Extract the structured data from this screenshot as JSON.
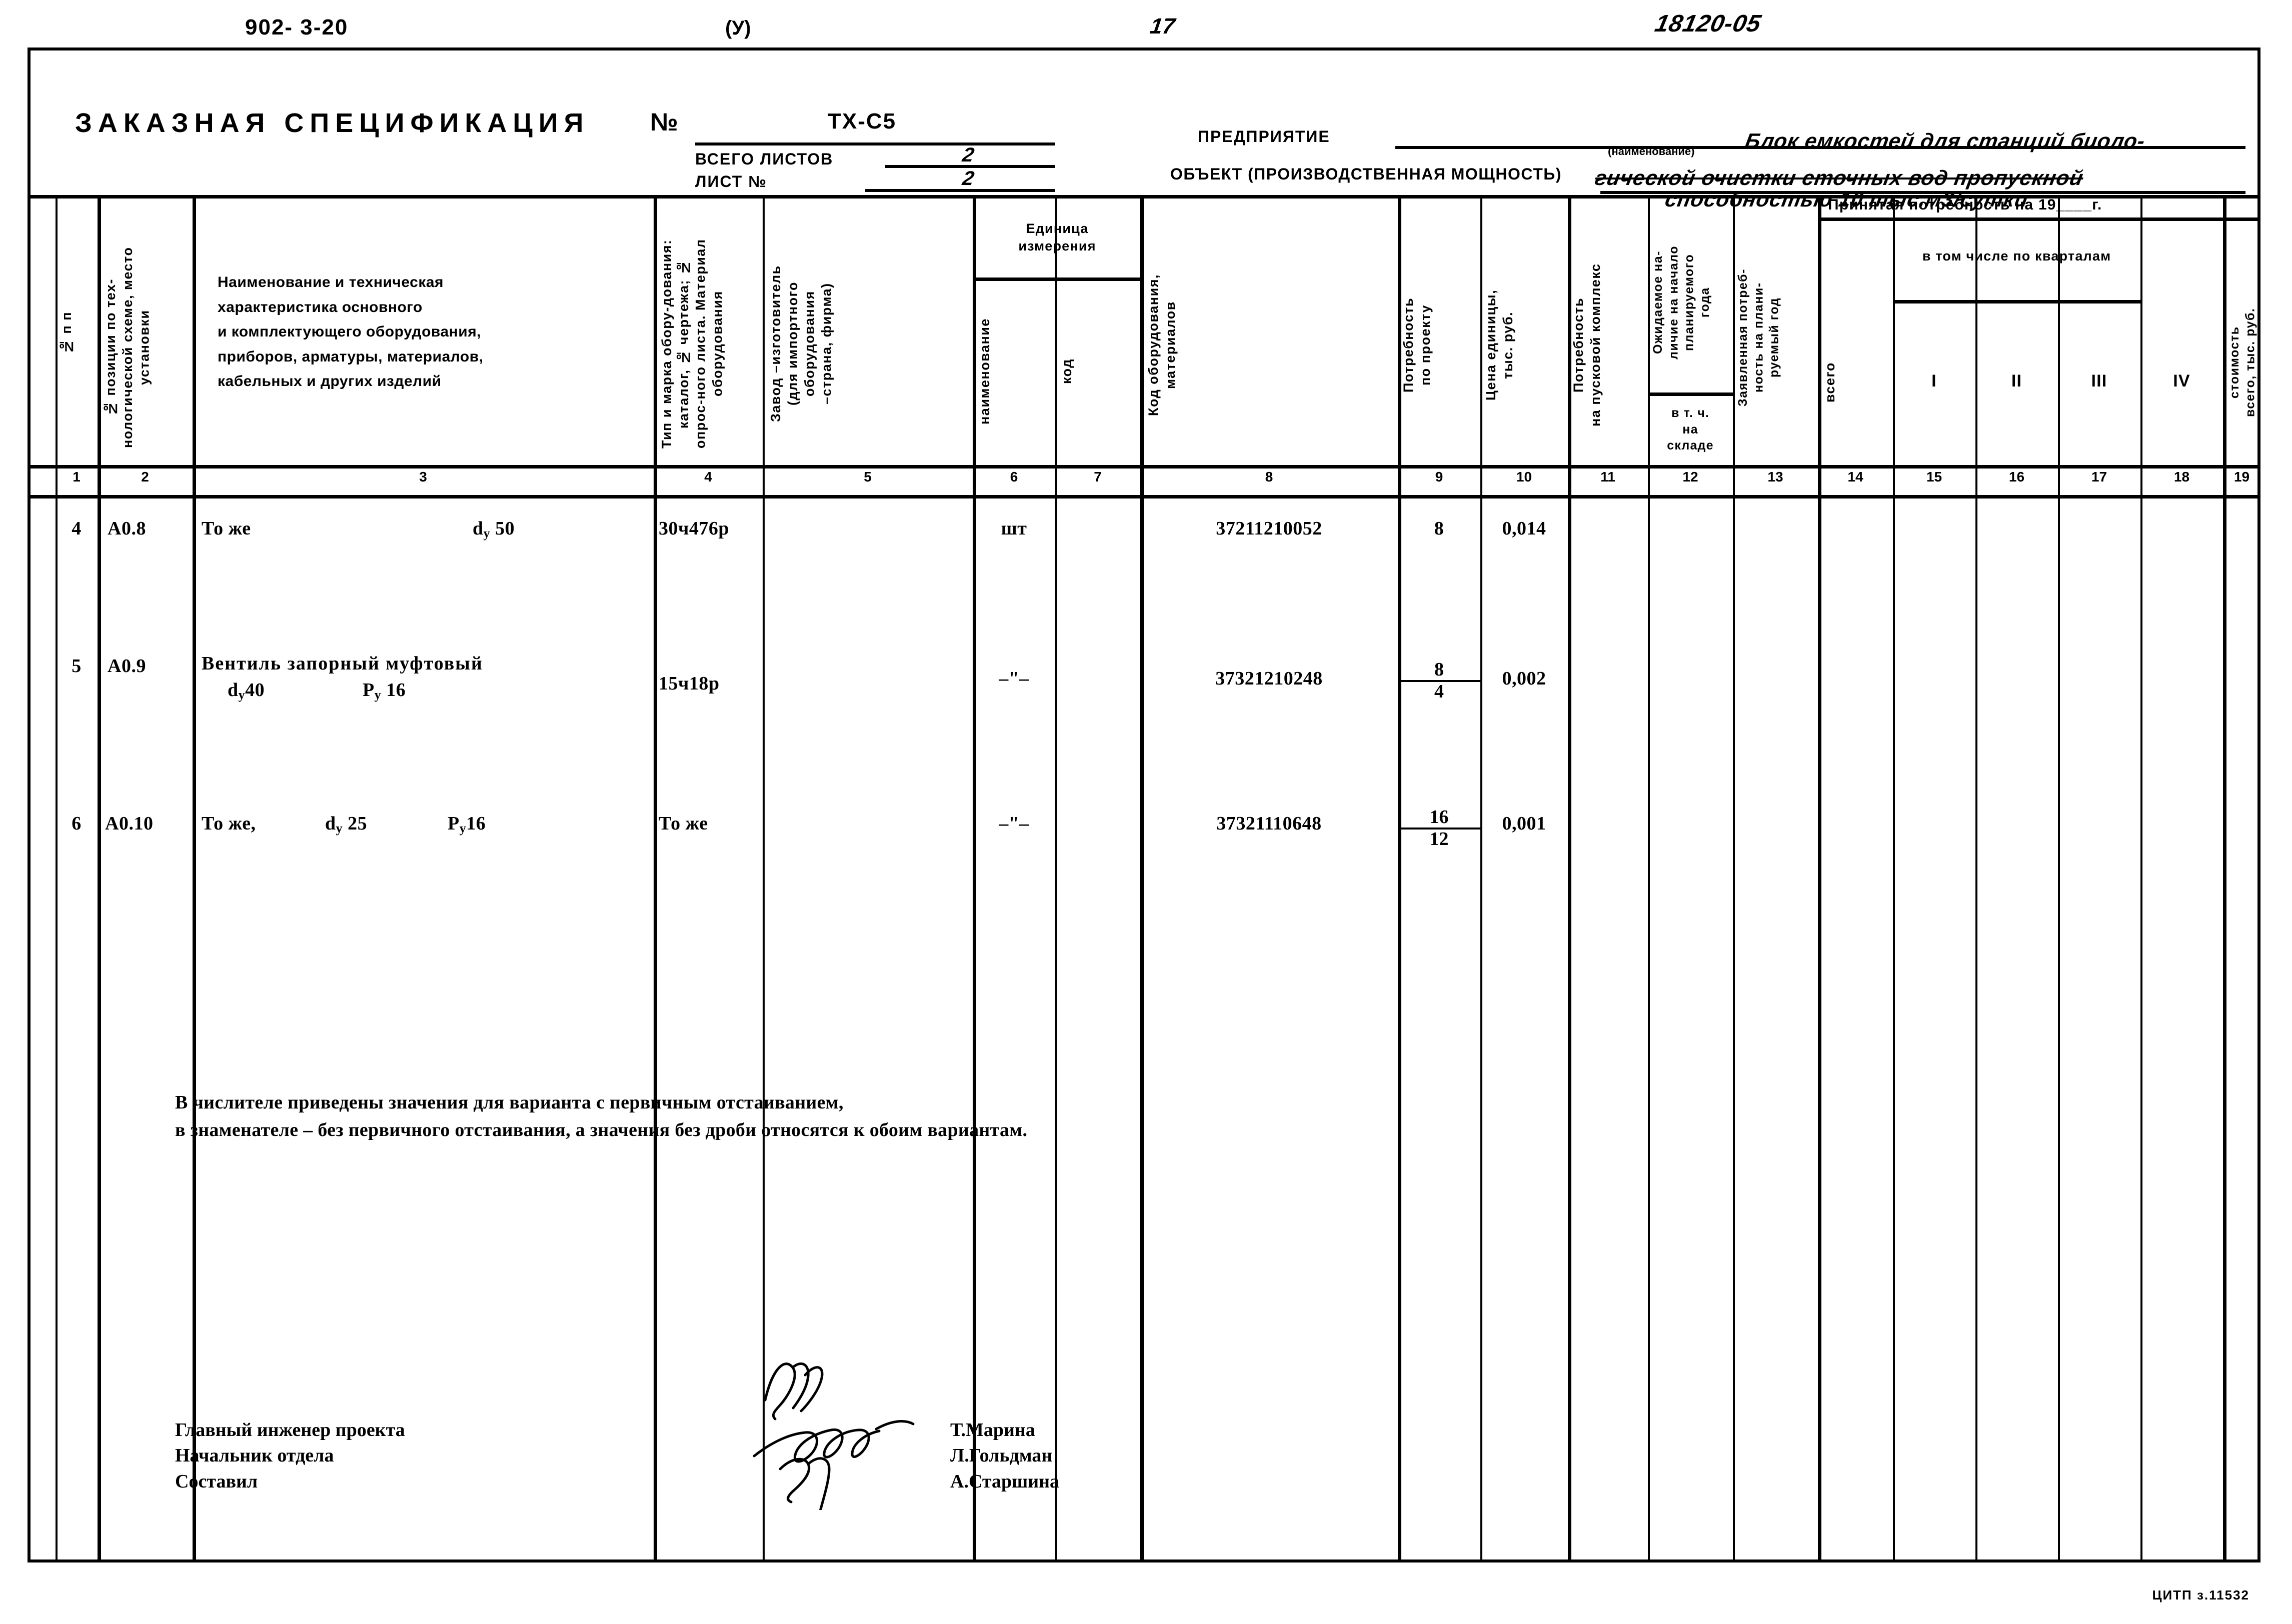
{
  "header": {
    "code_left": "902- 3-20",
    "code_mid": "(У)",
    "page_number": "17",
    "stamp_number": "18120-05"
  },
  "title_block": {
    "title": "ЗАКАЗНАЯ СПЕЦИФИКАЦИЯ",
    "number_label": "№",
    "number_value": "ТХ-С5",
    "total_sheets_label": "ВСЕГО ЛИСТОВ",
    "total_sheets_value": "2",
    "sheet_no_label": "ЛИСТ №",
    "sheet_no_value": "2",
    "enterprise_label": "ПРЕДПРИЯТИЕ",
    "naimenovanie_label": "(наименование)",
    "object_label": "ОБЪЕКТ (ПРОИЗВОДСТВЕННАЯ МОЩНОСТЬ)",
    "object_line1": "Блок емкостей для станций биоло-",
    "object_line2": "гической очистки сточных вод пропускной",
    "object_line3": "способностью 10 тыс.м3/сутки"
  },
  "columns": {
    "c1": "№ п п",
    "c2": "№ позиции по тех-нологической схеме, место установки",
    "c3": "Наименование и техническая\nхарактеристика основного\nи комплектующего оборудования,\nприборов, арматуры, материалов,\nкабельных и других изделий",
    "c4": "Тип и марка обору-дования: каталог, № чертежа; № опрос-ного листа. Материал оборудования",
    "c5": "Завод –изготовитель\n(для импортного\nоборудования\n–страна, фирма)",
    "unit_group": "Единица\nизмерения",
    "c6": "наименование",
    "c7": "код",
    "c8": "Код оборудования,\nматериалов",
    "c9": "Потребность\nпо проекту",
    "c10": "Цена единицы,\nтыс. руб.",
    "c11": "Потребность\nна пусковой комплекс",
    "c12": "Ожидаемое на-\nличие на начало\nпланируемого\nгода",
    "c12_sub": "в т. ч.\nна\nскладе",
    "c13": "Заявленная потреб-\nность на плани-\nруемый год",
    "accepted_group": "Принятая потребность на 19____г.",
    "quarters_group": "в том числе по кварталам",
    "c14": "всего",
    "c15": "I",
    "c16": "II",
    "c17": "III",
    "c18": "IV",
    "c19": "стоимость\nвсего, тыс. руб."
  },
  "column_numbers": [
    "1",
    "2",
    "3",
    "4",
    "5",
    "6",
    "7",
    "8",
    "9",
    "10",
    "11",
    "12",
    "13",
    "14",
    "15",
    "16",
    "17",
    "18",
    "19"
  ],
  "rows": [
    {
      "n": "4",
      "position": "А0.8",
      "name": "То же",
      "spec_d": "d",
      "spec_d_sub": "у",
      "spec_d_val": "50",
      "spec_p": "",
      "spec_p_sub": "",
      "spec_p_val": "",
      "type_mark": "30ч476р",
      "manufacturer": "",
      "unit_name": "шт",
      "unit_code": "",
      "equipment_code": "37211210052",
      "demand": "8",
      "demand_denominator": "",
      "price": "0,014"
    },
    {
      "n": "5",
      "position": "А0.9",
      "name": "Вентиль запорный муфтовый",
      "spec_d": "d",
      "spec_d_sub": "у",
      "spec_d_val": "40",
      "spec_p": "Р",
      "spec_p_sub": "у",
      "spec_p_val": "16",
      "type_mark": "15ч18р",
      "manufacturer": "",
      "unit_name": "–\"–",
      "unit_code": "",
      "equipment_code": "37321210248",
      "demand": "8",
      "demand_denominator": "4",
      "price": "0,002"
    },
    {
      "n": "6",
      "position": "А0.10",
      "name": "То же,",
      "spec_d": "d",
      "spec_d_sub": "у",
      "spec_d_val": "25",
      "spec_p": "Р",
      "spec_p_sub": "у",
      "spec_p_val": "16",
      "type_mark": "То же",
      "manufacturer": "",
      "unit_name": "–\"–",
      "unit_code": "",
      "equipment_code": "37321110648",
      "demand": "16",
      "demand_denominator": "12",
      "price": "0,001"
    }
  ],
  "note": {
    "line1": "В числителе приведены значения для варианта с первичным отстаиванием,",
    "line2": "в знаменателе – без первичного отстаивания, а значения без дроби относятся к обоим вариантам."
  },
  "signatures": {
    "roles": [
      "Главный инженер проекта",
      "Начальник отдела",
      "Составил"
    ],
    "names": [
      "Т.Марина",
      "Л.Гольдман",
      "А.Старшина"
    ]
  },
  "footer": {
    "text": "ЦИТП з.11532"
  }
}
